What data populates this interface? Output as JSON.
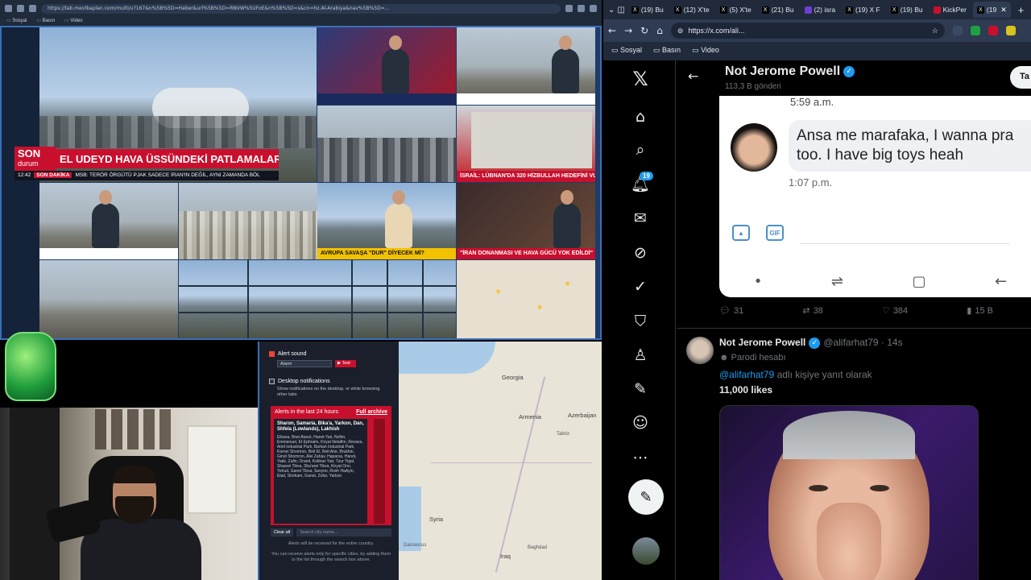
{
  "left_browser": {
    "url": "https://tab.mevtkaplan.com/multi/u?167&n%5B%5D=Haber&url%5B%5D=RNVW%5UFoE&n%5B%5D=s&cn=hz.Al-Arabiya&nav%5B%5D=...",
    "bookmarks": [
      "Sosyal",
      "Basın",
      "Video"
    ]
  },
  "video_wall": {
    "big_banner": {
      "son": "SON",
      "durum": "durum",
      "headline": "EL UDEYD HAVA ÜSSÜNDEKİ PATLAMALAR",
      "time": "12:42",
      "dakika": "SON DAKİKA",
      "sub": "MSB: TERÖR ÖRGÜTÜ PJAK SADECE İRAN'IN DEĞİL, AYNI ZAMANDA BÖL"
    },
    "tickers": {
      "israel": "İSRAİL: LÜBNAN'DA 320 HİZBULLAH HEDEFİNİ VURDUK",
      "avrupa": "AVRUPA SAVAŞA \"DUR\" DİYECEK Mİ?",
      "iran": "\"İRAN DONANMASI VE HAVA GÜCÜ YOK EDİLDİ\"",
      "son_dakika": "SON DAKİKA"
    }
  },
  "alerts_panel": {
    "alert_sound": "Alert sound",
    "alarm_option": "Alarm",
    "test": "▶ Test",
    "desktop_notifications": "Desktop notifications",
    "desktop_note": "Show notifications on the desktop, or while browsing other tabs",
    "last24": "Alerts in the last 24 hours",
    "full_archive": "Full archive",
    "alert_title": "Sharon, Samaria, Bika'a, Yarkon, Dan, Shfela (Lowlands), Lakhish",
    "alert_list": "Elkana, Bnei Atarot, Hanot Yair, Nofim, Emmanuel, Et Ephraim, Kiryat Netafim, Revava, Ariel industrial Park, Barkan Industrial Park, Karnei Shomron, Beit El, Beit Arie, Brukhin, Ginot Shomron, Alei Zahav, Haparsa, Hanot, Yakir, Zufin, Oranit, Kokhav Yair, Tzur Yigal, Shaarei Tikva, Sha'arei Tikva, Kiryat Ono, Yehud, Ganei Tikva, Savyon, Rosh HaAyin, Elad, Shoham, Ganot, Zofar, Yarkon",
    "clear_all": "Clear all",
    "search_placeholder": "Search city name...",
    "foot1": "Alerts will be received for the entire country.",
    "foot2": "You can receive alerts only for specific cities, by adding them to the list through the search box above."
  },
  "map": {
    "labels": [
      "Georgia",
      "Armenia",
      "Azerbaijan",
      "Tabriz",
      "Syria",
      "Damascus",
      "Iraq",
      "Baghdad"
    ]
  },
  "right_browser": {
    "tabs": [
      {
        "label": "(19) Bu",
        "fav": "X"
      },
      {
        "label": "(12) X'te",
        "fav": "X"
      },
      {
        "label": "(5) X'te",
        "fav": "X"
      },
      {
        "label": "(21) Bu",
        "fav": "X"
      },
      {
        "label": "(2) isra",
        "fav": "purple"
      },
      {
        "label": "(19) X F",
        "fav": "X"
      },
      {
        "label": "(19) Bu",
        "fav": "X"
      },
      {
        "label": "KickPer",
        "fav": "red"
      },
      {
        "label": "(19",
        "fav": "X"
      }
    ],
    "url": "https://x.com/ali...",
    "bookmarks": [
      "Sosyal",
      "Basın",
      "Video"
    ]
  },
  "x_nav": {
    "notification_count": "19"
  },
  "profile_header": {
    "name": "Not Jerome Powell",
    "posts_count": "113,3 B gönderi",
    "follow_label": "Ta"
  },
  "embedded_screenshot": {
    "time1": "5:59 a.m.",
    "message_line1": "Ansa me marafaka, I wanna pra",
    "message_line2": "too. I have big toys heah",
    "time2": "1:07 p.m.",
    "gif_label": "GIF"
  },
  "tweet1_stats": {
    "replies": "31",
    "reposts": "38",
    "likes": "384",
    "views": "15 B"
  },
  "tweet2": {
    "name": "Not Jerome Powell",
    "handle": "@alifarhat79 · 14s",
    "parody": "Parodi hesabı",
    "reply_prefix": "@alifarhat79",
    "reply_suffix": " adlı kişiye yanıt olarak",
    "text": "11,000 likes"
  },
  "colors": {
    "x_blue": "#1d9bf0",
    "news_red": "#c8102e",
    "x_bg": "#000000"
  }
}
